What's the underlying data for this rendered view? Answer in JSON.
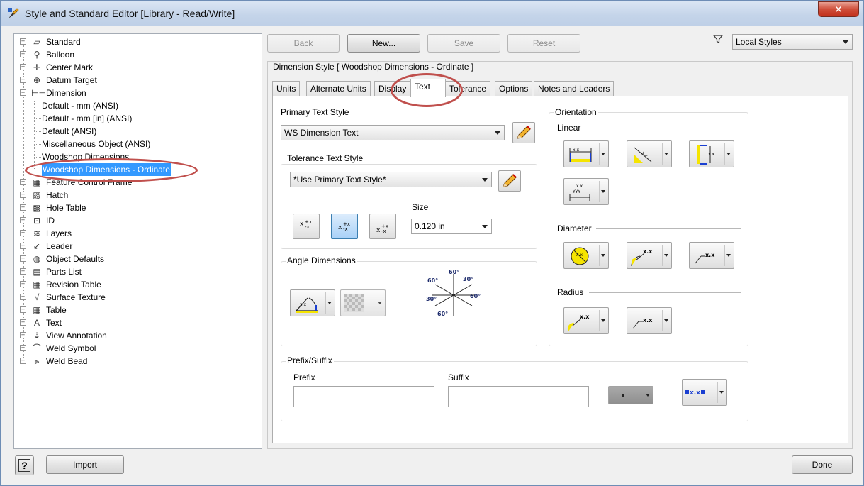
{
  "window": {
    "title": "Style and Standard Editor [Library - Read/Write]",
    "close_label": "✕"
  },
  "tree": {
    "items": [
      {
        "label": "Standard",
        "icon": "standard-icon",
        "glyph": "▱"
      },
      {
        "label": "Balloon",
        "icon": "balloon-icon",
        "glyph": "⚲"
      },
      {
        "label": "Center Mark",
        "icon": "center-mark-icon",
        "glyph": "✛"
      },
      {
        "label": "Datum Target",
        "icon": "datum-target-icon",
        "glyph": "⊕"
      },
      {
        "label": "Dimension",
        "icon": "dimension-icon",
        "glyph": "⊢⊣"
      },
      {
        "label": "Feature Control Frame",
        "icon": "feature-control-frame-icon",
        "glyph": "▦"
      },
      {
        "label": "Hatch",
        "icon": "hatch-icon",
        "glyph": "▨"
      },
      {
        "label": "Hole Table",
        "icon": "hole-table-icon",
        "glyph": "▩"
      },
      {
        "label": "ID",
        "icon": "id-icon",
        "glyph": "⊡"
      },
      {
        "label": "Layers",
        "icon": "layers-icon",
        "glyph": "≋"
      },
      {
        "label": "Leader",
        "icon": "leader-icon",
        "glyph": "↙"
      },
      {
        "label": "Object Defaults",
        "icon": "object-defaults-icon",
        "glyph": "◍"
      },
      {
        "label": "Parts List",
        "icon": "parts-list-icon",
        "glyph": "▤"
      },
      {
        "label": "Revision Table",
        "icon": "revision-table-icon",
        "glyph": "▦"
      },
      {
        "label": "Surface Texture",
        "icon": "surface-texture-icon",
        "glyph": "√"
      },
      {
        "label": "Table",
        "icon": "table-icon",
        "glyph": "▦"
      },
      {
        "label": "Text",
        "icon": "text-icon",
        "glyph": "A"
      },
      {
        "label": "View Annotation",
        "icon": "view-annotation-icon",
        "glyph": "⇣"
      },
      {
        "label": "Weld Symbol",
        "icon": "weld-symbol-icon",
        "glyph": "⌒"
      },
      {
        "label": "Weld Bead",
        "icon": "weld-bead-icon",
        "glyph": "⫸"
      }
    ],
    "dimension_children": [
      "Default - mm (ANSI)",
      "Default - mm [in] (ANSI)",
      "Default (ANSI)",
      "Miscellaneous Object (ANSI)",
      "Woodshop Dimensions",
      "Woodshop Dimensions - Ordinate"
    ]
  },
  "toolbar": {
    "back": "Back",
    "new": "New...",
    "save": "Save",
    "reset": "Reset",
    "filter_value": "Local Styles"
  },
  "style_header": "Dimension Style [ Woodshop Dimensions - Ordinate ]",
  "tabs": [
    "Units",
    "Alternate Units",
    "Display",
    "Text",
    "Tolerance",
    "Options",
    "Notes and Leaders"
  ],
  "text_tab": {
    "primary_text_style_label": "Primary Text Style",
    "primary_text_style_value": "WS Dimension Text",
    "tolerance_text_style_label": "Tolerance Text Style",
    "tolerance_text_style_value": "*Use Primary Text Style*",
    "size_label": "Size",
    "size_value": "0.120 in",
    "angle_dimensions_label": "Angle Dimensions",
    "orientation_label": "Orientation",
    "linear_label": "Linear",
    "diameter_label": "Diameter",
    "radius_label": "Radius",
    "prefix_suffix_label": "Prefix/Suffix",
    "prefix_label": "Prefix",
    "suffix_label": "Suffix",
    "prefix_value": "",
    "suffix_value": "",
    "angle_labels": [
      "60°",
      "30°",
      "60°",
      "30°",
      "60°",
      "60°"
    ]
  },
  "bottom": {
    "help": "?",
    "import": "Import",
    "done": "Done"
  },
  "colors": {
    "highlight_oval": "#c0504d",
    "selection": "#3399ff",
    "icon_yellow": "#f5e400",
    "icon_blue": "#1a3fd1"
  }
}
